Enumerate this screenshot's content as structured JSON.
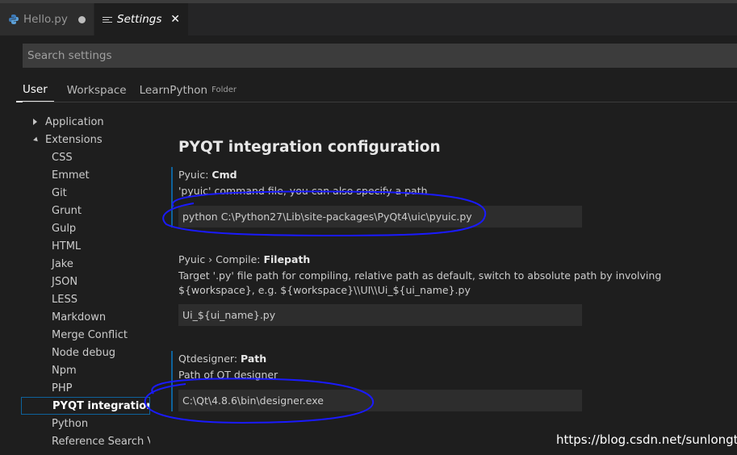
{
  "tabs": [
    {
      "label": "Hello.py",
      "icon": "python-icon",
      "modified": true
    },
    {
      "label": "Settings",
      "icon": "settings-file-icon",
      "close": "✕"
    }
  ],
  "search": {
    "placeholder": "Search settings"
  },
  "scopes": {
    "user": "User",
    "workspace": "Workspace",
    "folder_name": "LearnPython",
    "folder_tag": "Folder"
  },
  "tree": {
    "top": [
      {
        "label": "Application",
        "expanded": false
      },
      {
        "label": "Extensions",
        "expanded": true
      }
    ],
    "extensions": [
      "CSS",
      "Emmet",
      "Git",
      "Grunt",
      "Gulp",
      "HTML",
      "Jake",
      "JSON",
      "LESS",
      "Markdown",
      "Merge Conflict",
      "Node debug",
      "Npm",
      "PHP",
      "PYQT integration ...",
      "Python",
      "Reference Search V..."
    ]
  },
  "content": {
    "section_title": "PYQT integration configuration",
    "settings": [
      {
        "category": "Pyuic: ",
        "key": "Cmd",
        "description": "'pyuic' command file, you can also specify a path",
        "value": "python C:\\Python27\\Lib\\site-packages\\PyQt4\\uic\\pyuic.py"
      },
      {
        "category": "Pyuic › Compile: ",
        "key": "Filepath",
        "description": "Target '.py' file path for compiling, relative path as default, switch to absolute path by involving ${workspace}, e.g. ${workspace}\\\\UI\\\\Ui_${ui_name}.py",
        "value": "Ui_${ui_name}.py"
      },
      {
        "category": "Qtdesigner: ",
        "key": "Path",
        "description": "Path of QT designer",
        "value": "C:\\Qt\\4.8.6\\bin\\designer.exe"
      }
    ]
  },
  "watermark": "https://blog.csdn.net/sunlongtu",
  "colors": {
    "accent": "#0e639c",
    "annotation": "#1a1aff"
  }
}
